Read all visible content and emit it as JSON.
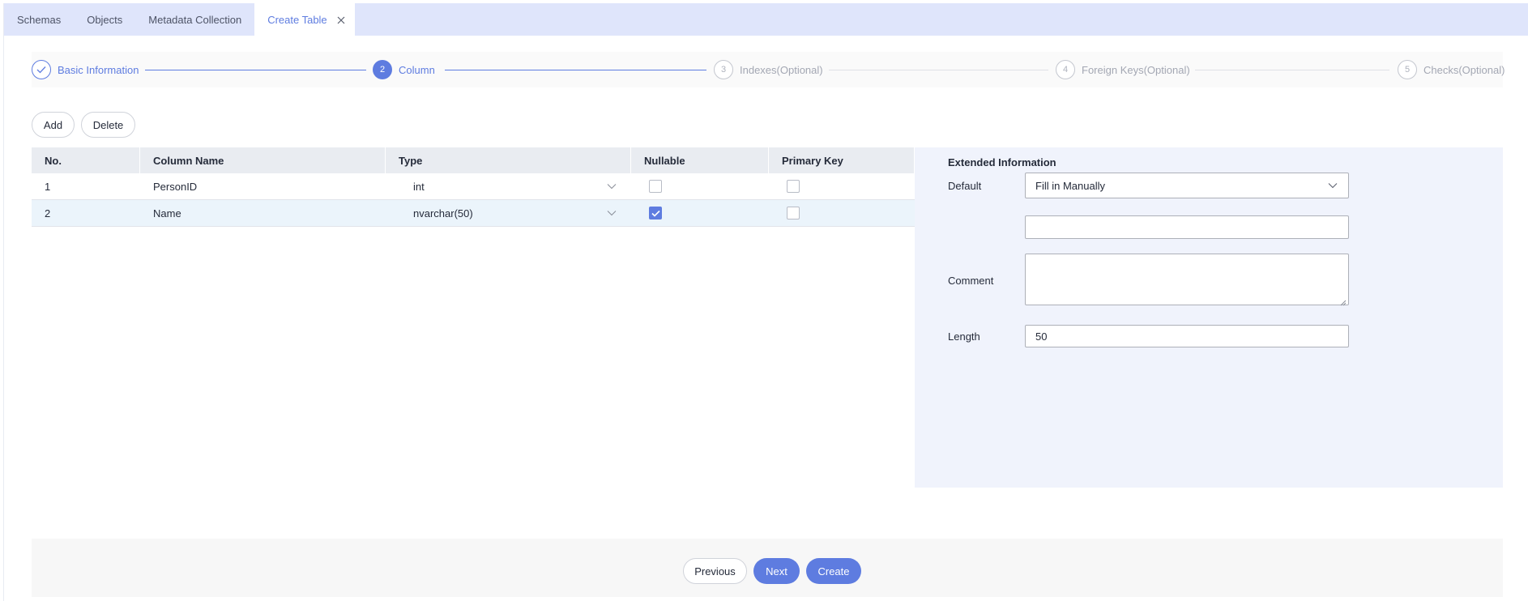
{
  "tabs": [
    {
      "label": "Schemas",
      "active": false
    },
    {
      "label": "Objects",
      "active": false
    },
    {
      "label": "Metadata Collection",
      "active": false
    },
    {
      "label": "Create Table",
      "active": true
    }
  ],
  "stepper": {
    "steps": [
      {
        "number": "",
        "label": "Basic Information",
        "state": "done"
      },
      {
        "number": "2",
        "label": "Column",
        "state": "active"
      },
      {
        "number": "3",
        "label": "Indexes(Optional)",
        "state": "todo"
      },
      {
        "number": "4",
        "label": "Foreign Keys(Optional)",
        "state": "todo"
      },
      {
        "number": "5",
        "label": "Checks(Optional)",
        "state": "todo"
      }
    ]
  },
  "toolbar": {
    "add_label": "Add",
    "delete_label": "Delete"
  },
  "table": {
    "columns": [
      "No.",
      "Column Name",
      "Type",
      "Nullable",
      "Primary Key"
    ],
    "rows": [
      {
        "no": "1",
        "name": "PersonID",
        "type": "int",
        "nullable": false,
        "primary_key": false,
        "selected": false
      },
      {
        "no": "2",
        "name": "Name",
        "type": "nvarchar(50)",
        "nullable": true,
        "primary_key": false,
        "selected": true
      }
    ]
  },
  "extended": {
    "title": "Extended Information",
    "default_label": "Default",
    "default_mode": "Fill in Manually",
    "default_value": "",
    "comment_label": "Comment",
    "comment_value": "",
    "length_label": "Length",
    "length_value": "50"
  },
  "footer": {
    "previous_label": "Previous",
    "next_label": "Next",
    "create_label": "Create"
  },
  "colors": {
    "accent": "#5e7ce0",
    "tabbar_bg": "#dfe5fb",
    "panel_bg": "#f0f3fc",
    "selected_row": "#ebf4fb"
  }
}
